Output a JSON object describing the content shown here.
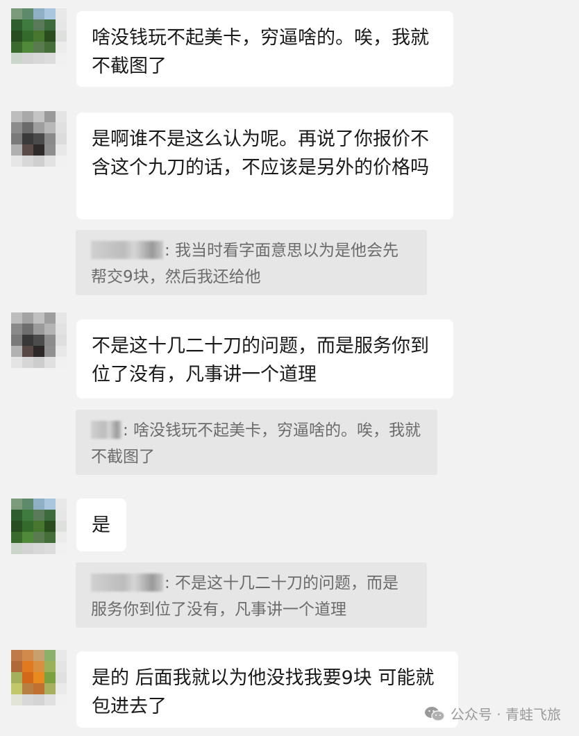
{
  "messages": [
    {
      "text": "啥没钱玩不起美卡，穷逼啥的。唉，我就不截图了"
    },
    {
      "text": "是啊谁不是这么认为呢。再说了你报价不含这个九刀的话，不应该是另外的价格吗"
    },
    {
      "text": "不是这十几二十刀的问题，而是服务你到位了没有，凡事讲一个道理"
    },
    {
      "text": "是"
    },
    {
      "text": "是的 后面我就以为他没找我要9块 可能就包进去了"
    }
  ],
  "quotes": [
    {
      "text": ": 我当时看字面意思以为是他会先帮交9块，然后我还给他"
    },
    {
      "text": ": 啥没钱玩不起美卡，穷逼啥的。唉，我就不截图了"
    },
    {
      "text": ": 不是这十几二十刀的问题，而是服务你到位了没有，凡事讲一个道理"
    }
  ],
  "watermark": {
    "text": "公众号 · 青蛙飞旅",
    "icon": "wechat-icon"
  },
  "colors": {
    "background": "#f2f2f2",
    "bubble": "#ffffff",
    "quote": "#e6e6e6",
    "text": "#191919",
    "quote_text": "#6b6b6b"
  }
}
